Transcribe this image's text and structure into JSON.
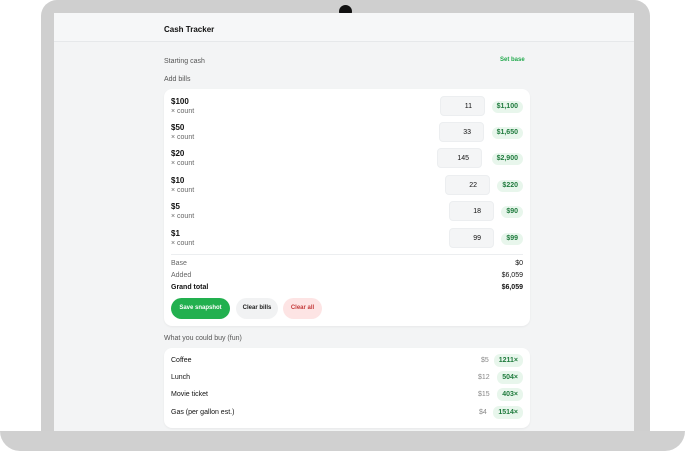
{
  "app": {
    "title": "Cash Tracker"
  },
  "starting_cash": {
    "label": "Starting cash",
    "action": "Set base"
  },
  "add_bills": {
    "label": "Add bills"
  },
  "bills": [
    {
      "denom": "$100",
      "sub": "× count",
      "count": "11",
      "total": "$1,100"
    },
    {
      "denom": "$50",
      "sub": "× count",
      "count": "33",
      "total": "$1,650"
    },
    {
      "denom": "$20",
      "sub": "× count",
      "count": "145",
      "total": "$2,900"
    },
    {
      "denom": "$10",
      "sub": "× count",
      "count": "22",
      "total": "$220"
    },
    {
      "denom": "$5",
      "sub": "× count",
      "count": "18",
      "total": "$90"
    },
    {
      "denom": "$1",
      "sub": "× count",
      "count": "99",
      "total": "$99"
    }
  ],
  "summary": {
    "base_label": "Base",
    "base_value": "$0",
    "added_label": "Added",
    "added_value": "$6,059",
    "grand_label": "Grand total",
    "grand_value": "$6,059"
  },
  "actions": {
    "save": "Save snapshot",
    "clear_bills": "Clear bills",
    "clear_all": "Clear all"
  },
  "buy": {
    "label": "What you could buy (fun)",
    "items": [
      {
        "name": "Coffee",
        "price": "$5",
        "count": "1211×"
      },
      {
        "name": "Lunch",
        "price": "$12",
        "count": "504×"
      },
      {
        "name": "Movie ticket",
        "price": "$15",
        "count": "403×"
      },
      {
        "name": "Gas (per gallon est.)",
        "price": "$4",
        "count": "1514×"
      }
    ]
  },
  "colors": {
    "accent": "#22b04f",
    "danger": "#c43b3b",
    "badge_bg": "#e8f6ec"
  }
}
